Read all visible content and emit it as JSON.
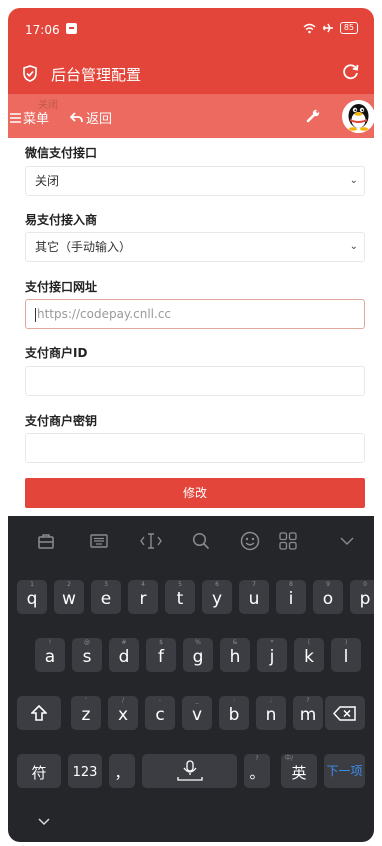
{
  "status": {
    "time": "17:06",
    "battery": "85"
  },
  "appbar": {
    "title": "后台管理配置"
  },
  "toolbar": {
    "menu_label": "菜单",
    "back_label": "返回",
    "ghost_text": "关闭"
  },
  "form": {
    "wechat_label": "微信支付接口",
    "wechat_value": "关闭",
    "provider_label": "易支付接入商",
    "provider_value": "其它（手动输入）",
    "url_label": "支付接口网址",
    "url_placeholder": "https://codepay.cnll.cc",
    "merchant_id_label": "支付商户ID",
    "merchant_key_label": "支付商户密钥",
    "submit_label": "修改"
  },
  "keyboard": {
    "row1": [
      {
        "k": "q",
        "h": "1"
      },
      {
        "k": "w",
        "h": "2"
      },
      {
        "k": "e",
        "h": "3"
      },
      {
        "k": "r",
        "h": "4"
      },
      {
        "k": "t",
        "h": "5"
      },
      {
        "k": "y",
        "h": "6"
      },
      {
        "k": "u",
        "h": "7"
      },
      {
        "k": "i",
        "h": "8"
      },
      {
        "k": "o",
        "h": "9"
      },
      {
        "k": "p",
        "h": "0"
      }
    ],
    "row2": [
      {
        "k": "a",
        "h": "!"
      },
      {
        "k": "s",
        "h": "@"
      },
      {
        "k": "d",
        "h": "#"
      },
      {
        "k": "f",
        "h": "$"
      },
      {
        "k": "g",
        "h": "%"
      },
      {
        "k": "h",
        "h": "&"
      },
      {
        "k": "j",
        "h": "*"
      },
      {
        "k": "k",
        "h": "("
      },
      {
        "k": "l",
        "h": ")"
      }
    ],
    "row3": [
      {
        "k": "z",
        "h": "'"
      },
      {
        "k": "x",
        "h": "/"
      },
      {
        "k": "c",
        "h": "-"
      },
      {
        "k": "v",
        "h": "_"
      },
      {
        "k": "b",
        "h": ":"
      },
      {
        "k": "n",
        "h": ";"
      },
      {
        "k": "m",
        "h": "?"
      }
    ],
    "symbol_label": "符",
    "numbers_label": "123",
    "comma_key": "，",
    "period_key": "。",
    "period_hint": "?",
    "lang_label": "英",
    "lang_hint": "中/",
    "next_label": "下一项"
  },
  "colors": {
    "brand": "#e4453a",
    "keyboard_bg": "#25262a",
    "key_bg": "#3c3d42",
    "next_blue": "#3b8ef0"
  }
}
